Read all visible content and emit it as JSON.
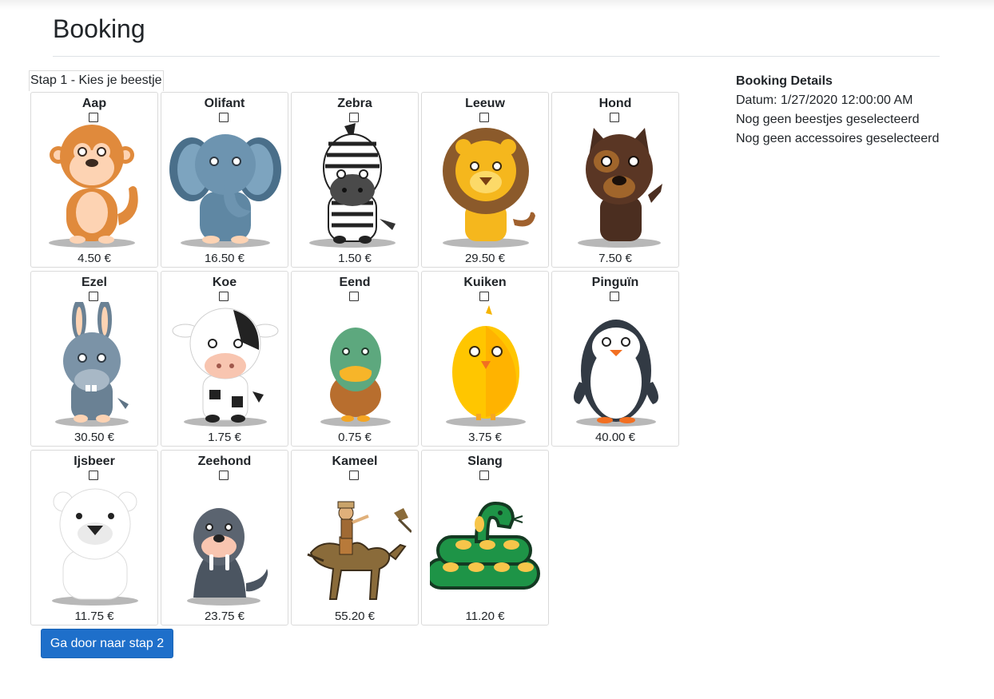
{
  "page": {
    "title": "Booking"
  },
  "step": {
    "label": "Stap 1 - Kies je beestje"
  },
  "animals": [
    {
      "name": "Aap",
      "price": "4.50 €",
      "icon": "monkey-icon"
    },
    {
      "name": "Olifant",
      "price": "16.50 €",
      "icon": "elephant-icon"
    },
    {
      "name": "Zebra",
      "price": "1.50 €",
      "icon": "zebra-icon"
    },
    {
      "name": "Leeuw",
      "price": "29.50 €",
      "icon": "lion-icon"
    },
    {
      "name": "Hond",
      "price": "7.50 €",
      "icon": "dog-icon"
    },
    {
      "name": "Ezel",
      "price": "30.50 €",
      "icon": "donkey-icon"
    },
    {
      "name": "Koe",
      "price": "1.75 €",
      "icon": "cow-icon"
    },
    {
      "name": "Eend",
      "price": "0.75 €",
      "icon": "duck-icon"
    },
    {
      "name": "Kuiken",
      "price": "3.75 €",
      "icon": "chick-icon"
    },
    {
      "name": "Pinguïn",
      "price": "40.00 €",
      "icon": "penguin-icon"
    },
    {
      "name": "Ijsbeer",
      "price": "11.75 €",
      "icon": "polar-bear-icon"
    },
    {
      "name": "Zeehond",
      "price": "23.75 €",
      "icon": "seal-icon"
    },
    {
      "name": "Kameel",
      "price": "55.20 €",
      "icon": "camel-icon"
    },
    {
      "name": "Slang",
      "price": "11.20 €",
      "icon": "snake-icon"
    }
  ],
  "actions": {
    "next_label": "Ga door naar stap 2"
  },
  "details": {
    "title": "Booking Details",
    "date": "Datum: 1/27/2020 12:00:00 AM",
    "animals_status": "Nog geen beestjes geselecteerd",
    "accessories_status": "Nog geen accessoires geselecteerd"
  },
  "colors": {
    "primary": "#1e6fca",
    "border": "#dadada",
    "text": "#212529"
  }
}
